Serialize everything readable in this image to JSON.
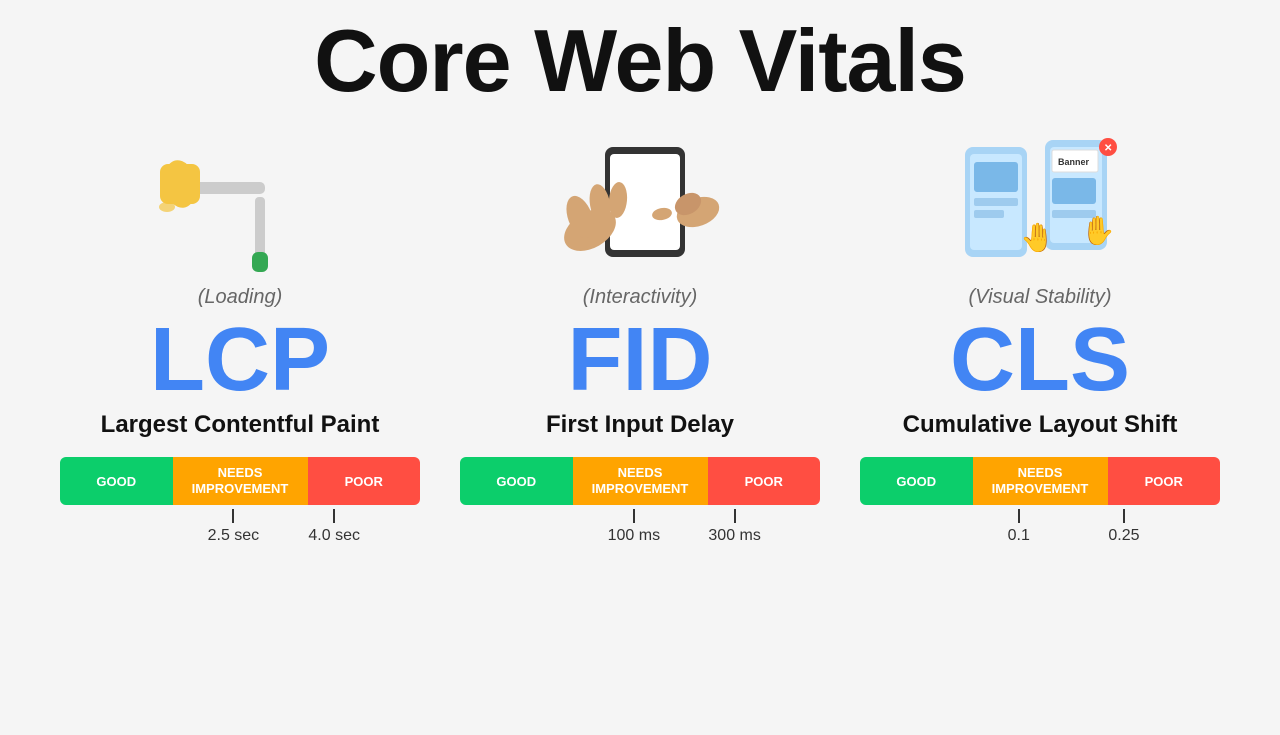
{
  "page": {
    "title": "Core Web Vitals"
  },
  "metrics": [
    {
      "id": "lcp",
      "abbr": "LCP",
      "name": "Largest Contentful Paint",
      "category": "(Loading)",
      "bar": {
        "good": "GOOD",
        "needs": "NEEDS\nIMPROVEMENT",
        "poor": "POOR"
      },
      "markers": [
        "2.5 sec",
        "4.0 sec"
      ]
    },
    {
      "id": "fid",
      "abbr": "FID",
      "name": "First Input Delay",
      "category": "(Interactivity)",
      "bar": {
        "good": "GOOD",
        "needs": "NEEDS\nIMPROVEMENT",
        "poor": "POOR"
      },
      "markers": [
        "100 ms",
        "300 ms"
      ]
    },
    {
      "id": "cls",
      "abbr": "CLS",
      "name": "Cumulative Layout Shift",
      "category": "(Visual Stability)",
      "bar": {
        "good": "GOOD",
        "needs": "NEEDS\nIMPROVEMENT",
        "poor": "POOR"
      },
      "markers": [
        "0.1",
        "0.25"
      ]
    }
  ],
  "colors": {
    "good": "#0cce6b",
    "needs": "#ffa400",
    "poor": "#ff4e42",
    "accent": "#4285f4"
  }
}
